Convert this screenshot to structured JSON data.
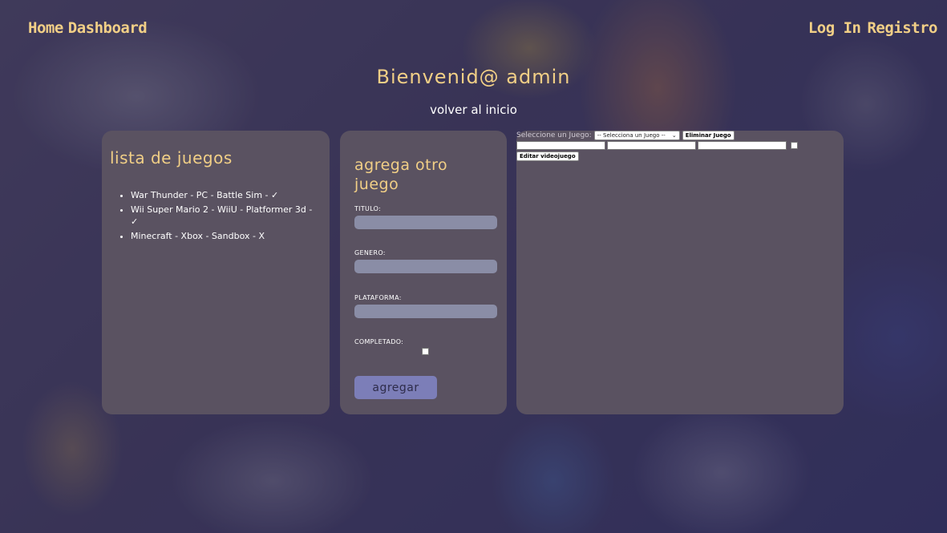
{
  "nav": {
    "home": "Home",
    "dashboard": "Dashboard",
    "login": "Log In",
    "register": "Registro"
  },
  "header": {
    "title": "Bienvenid@ admin",
    "back_link": "volver al inicio"
  },
  "game_list": {
    "heading": "lista de juegos",
    "items": [
      "War Thunder - PC - Battle Sim - ✓",
      "Wii Super Mario 2 - WiiU - Platformer 3d - ✓",
      "Minecraft - Xbox - Sandbox - X"
    ]
  },
  "add_form": {
    "heading": "agrega otro juego",
    "title_label": "TITULO:",
    "genre_label": "GENERO:",
    "platform_label": "PLATAFORMA:",
    "completed_label": "COMPLETADO:",
    "submit_label": "agregar"
  },
  "edit_form": {
    "select_label": "Seleccione un Juego:",
    "select_value": "-- Selecciona un Juego --",
    "delete_label": "Eliminar Juego",
    "edit_label": "Editar videojuego"
  },
  "colors": {
    "accent": "#f1cf86",
    "panel": "#5a5261",
    "input": "#8a8da6",
    "button": "#7c7eb8"
  }
}
